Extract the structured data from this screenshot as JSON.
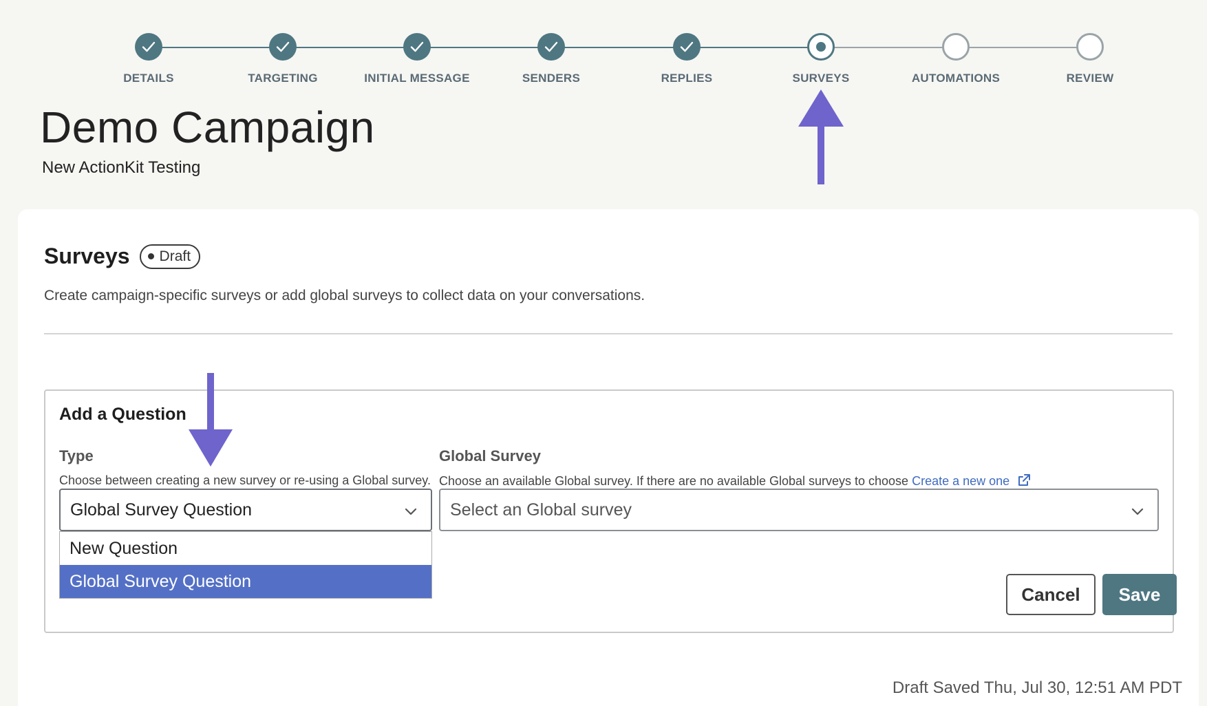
{
  "stepper": {
    "steps": [
      {
        "label": "DETAILS",
        "state": "done"
      },
      {
        "label": "TARGETING",
        "state": "done"
      },
      {
        "label": "INITIAL MESSAGE",
        "state": "done"
      },
      {
        "label": "SENDERS",
        "state": "done"
      },
      {
        "label": "REPLIES",
        "state": "done"
      },
      {
        "label": "SURVEYS",
        "state": "current"
      },
      {
        "label": "AUTOMATIONS",
        "state": "todo"
      },
      {
        "label": "REVIEW",
        "state": "todo"
      }
    ]
  },
  "header": {
    "title": "Demo Campaign",
    "subtitle": "New ActionKit Testing"
  },
  "section": {
    "title": "Surveys",
    "badge": "Draft",
    "description": "Create campaign-specific surveys or add global surveys to collect data on your conversations."
  },
  "question": {
    "title": "Add a Question",
    "type": {
      "label": "Type",
      "help": "Choose between creating a new survey or re-using a Global survey.",
      "value": "Global Survey Question",
      "options": [
        "New Question",
        "Global Survey Question"
      ]
    },
    "global_survey": {
      "label": "Global Survey",
      "help": "Choose an available Global survey. If there are no available Global surveys to choose",
      "link_text": "Create a new one",
      "placeholder": "Select an Global survey"
    },
    "cancel_label": "Cancel",
    "save_label": "Save"
  },
  "footer": {
    "draft_saved": "Draft Saved Thu, Jul 30, 12:51 AM PDT"
  },
  "colors": {
    "primary": "#4e7782",
    "accent_arrow": "#6e64cc",
    "selected_option": "#5470c6",
    "link": "#3f6bbf"
  },
  "icons": [
    "check-icon",
    "chevron-down-icon",
    "external-link-icon",
    "arrow-up-icon",
    "arrow-down-icon"
  ]
}
